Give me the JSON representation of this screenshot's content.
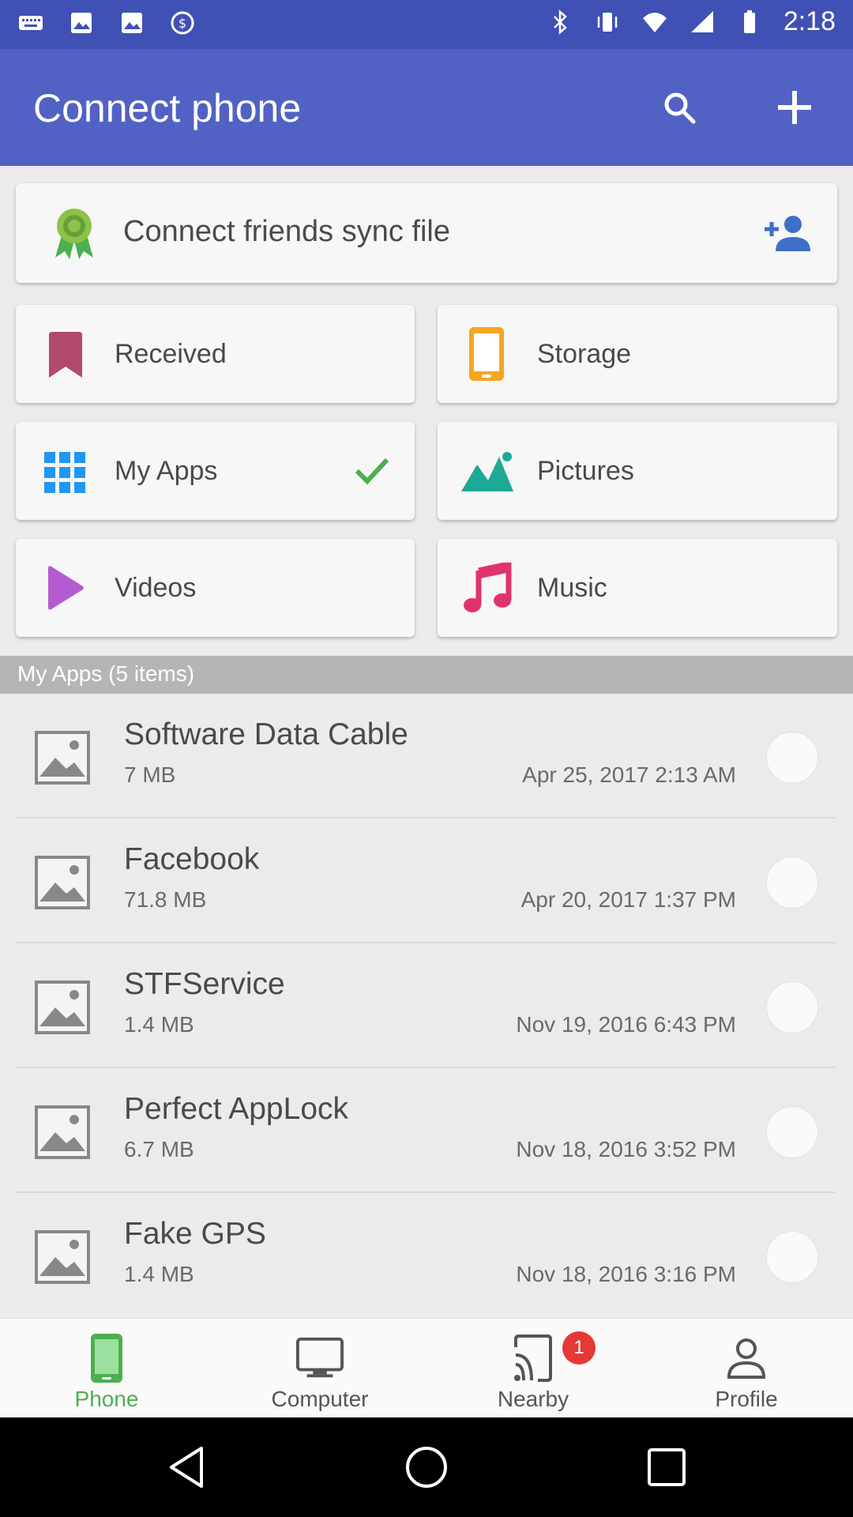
{
  "status_bar": {
    "time": "2:18"
  },
  "app_bar": {
    "title": "Connect phone",
    "search_icon": "search-icon",
    "add_icon": "add-icon"
  },
  "friends_card": {
    "label": "Connect friends sync file",
    "badge_icon": "award-icon",
    "action_icon": "add-person-icon"
  },
  "categories": [
    {
      "label": "Received",
      "icon": "bookmark-icon",
      "color": "#b24a6b"
    },
    {
      "label": "Storage",
      "icon": "phone-icon",
      "color": "#f5a623"
    },
    {
      "label": "My Apps",
      "icon": "apps-grid-icon",
      "color": "#2196f3",
      "checked": true
    },
    {
      "label": "Pictures",
      "icon": "landscape-icon",
      "color": "#1ea896"
    },
    {
      "label": "Videos",
      "icon": "play-icon",
      "color": "#b55bd1"
    },
    {
      "label": "Music",
      "icon": "music-note-icon",
      "color": "#e0336d"
    }
  ],
  "section": {
    "title": "My Apps (5 items)"
  },
  "apps": [
    {
      "name": "Software Data Cable",
      "size": "7 MB",
      "date": "Apr 25, 2017 2:13 AM"
    },
    {
      "name": "Facebook",
      "size": "71.8 MB",
      "date": "Apr 20, 2017 1:37 PM"
    },
    {
      "name": "STFService",
      "size": "1.4 MB",
      "date": "Nov 19, 2016 6:43 PM"
    },
    {
      "name": "Perfect AppLock",
      "size": "6.7 MB",
      "date": "Nov 18, 2016 3:52 PM"
    },
    {
      "name": "Fake GPS",
      "size": "1.4 MB",
      "date": "Nov 18, 2016 3:16 PM"
    }
  ],
  "bottom_nav": {
    "items": [
      {
        "label": "Phone",
        "active": true
      },
      {
        "label": "Computer"
      },
      {
        "label": "Nearby",
        "badge": "1"
      },
      {
        "label": "Profile"
      }
    ]
  },
  "colors": {
    "primary": "#5262c4",
    "status": "#3f51b5",
    "accent": "#4caf50"
  }
}
